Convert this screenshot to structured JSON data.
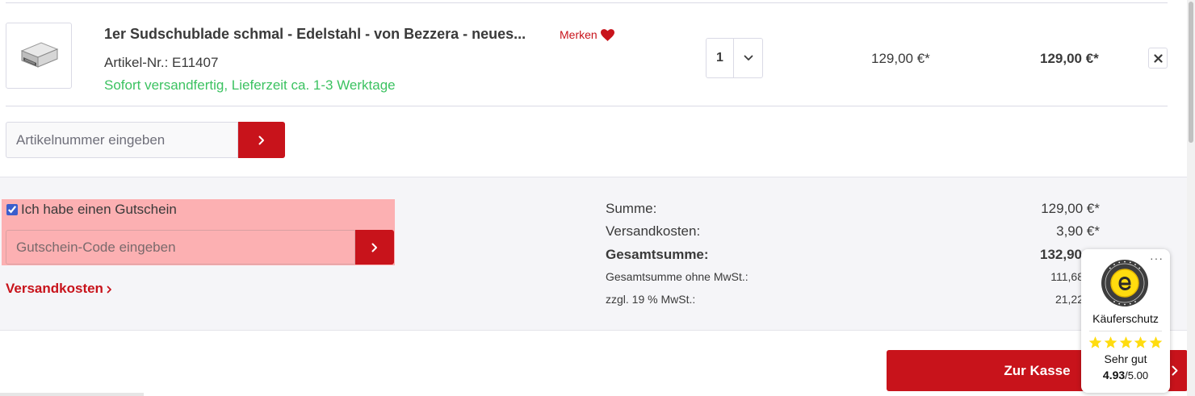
{
  "cart_item": {
    "title": "1er Sudschublade schmal - Edelstahl - von Bezzera - neues...",
    "merken_label": "Merken",
    "article_number": "Artikel-Nr.: E11407",
    "delivery_info": "Sofort versandfertig, Lieferzeit ca. 1-3 Werktage",
    "quantity": "1",
    "unit_price": "129,00 €*",
    "total_price": "129,00 €*",
    "image_icon": "drawer-product-image",
    "remove_icon": "close-icon"
  },
  "add_article": {
    "placeholder": "Artikelnummer eingeben",
    "button_icon": "chevron-right-icon"
  },
  "voucher": {
    "checkbox_label": "Ich habe einen Gutschein",
    "checked": true,
    "placeholder": "Gutschein-Code eingeben",
    "button_icon": "chevron-right-icon"
  },
  "shipping_link": "Versandkosten",
  "summary": {
    "summe_label": "Summe:",
    "summe_value": "129,00 €*",
    "versand_label": "Versandkosten:",
    "versand_value": "3,90 €*",
    "gesamt_label": "Gesamtsumme:",
    "gesamt_value": "132,90",
    "netto_label": "Gesamtsumme ohne MwSt.:",
    "netto_value": "111,68",
    "mwst_label": "zzgl. 19 % MwSt.:",
    "mwst_value": "21,22"
  },
  "checkout_button": "Zur Kasse",
  "trusted_shops": {
    "menu": "···",
    "title": "Käuferschutz",
    "rating_text": "Sehr gut",
    "score": "4.93",
    "max_score": "/5.00",
    "stars": 5,
    "star_color": "#ffdc0f"
  },
  "colors": {
    "primary": "#c8131b",
    "success": "#3cc261",
    "voucher_highlight": "#fcb0b2",
    "summary_bg": "#f5f5f8"
  }
}
